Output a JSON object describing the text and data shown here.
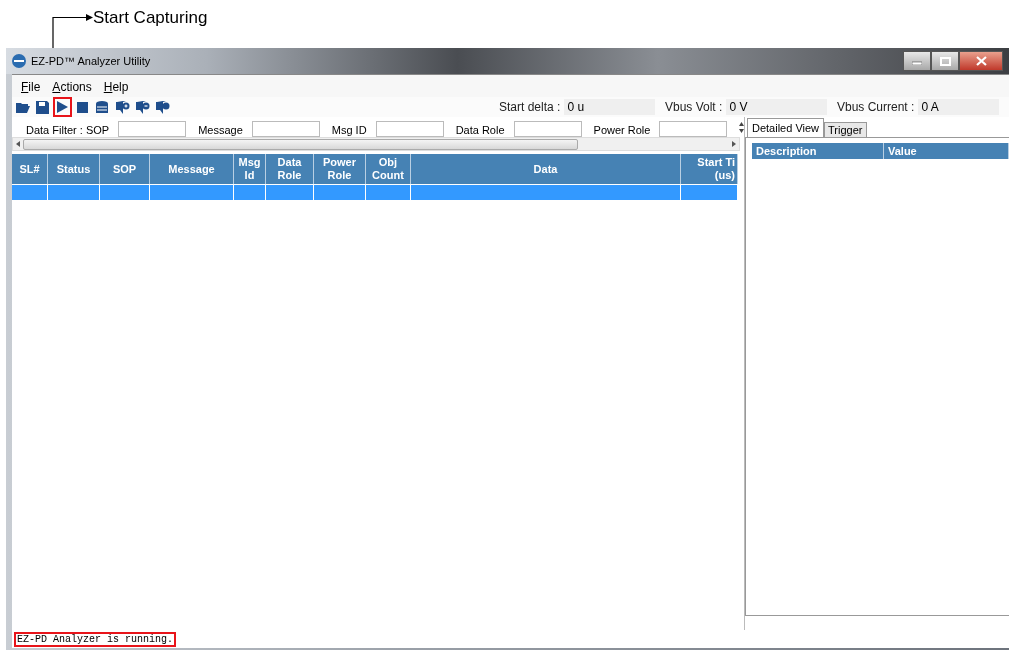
{
  "annotation": {
    "label": "Start Capturing"
  },
  "window": {
    "title": "EZ-PD™ Analyzer Utility"
  },
  "menu": [
    {
      "label": "File"
    },
    {
      "label": "Actions"
    },
    {
      "label": "Help"
    }
  ],
  "toolbar": [
    {
      "kind": "open",
      "highlighted": false
    },
    {
      "kind": "save",
      "highlighted": false
    },
    {
      "kind": "play",
      "highlighted": true
    },
    {
      "kind": "stop",
      "highlighted": false
    },
    {
      "kind": "database",
      "highlighted": false
    },
    {
      "kind": "tag-plus",
      "highlighted": false
    },
    {
      "kind": "tag-minus",
      "highlighted": false
    },
    {
      "kind": "tag",
      "highlighted": false
    }
  ],
  "readouts": [
    {
      "label": "Start delta :",
      "value": "0 u"
    },
    {
      "label": "Vbus Volt :",
      "value": "0 V"
    },
    {
      "label": "Vbus Current :",
      "value": "0 A"
    }
  ],
  "filters": [
    {
      "label": "Data Filter : SOP"
    },
    {
      "label": "Message"
    },
    {
      "label": "Msg ID"
    },
    {
      "label": "Data Role"
    },
    {
      "label": "Power Role"
    }
  ],
  "table": {
    "columns": [
      "SL#",
      "Status",
      "SOP",
      "Message",
      "Msg\nId",
      "Data\nRole",
      "Power\nRole",
      "Obj\nCount",
      "Data",
      "Start Ti\n(us)"
    ],
    "rows": [
      {
        "selected": true
      }
    ]
  },
  "detail": {
    "tabs": [
      {
        "label": "Detailed View",
        "selected": true
      },
      {
        "label": "Trigger",
        "selected": false
      }
    ],
    "columns": [
      "Description",
      "Value"
    ]
  },
  "status_bar": {
    "text": "EZ-PD Analyzer is running.",
    "highlighted": true
  }
}
